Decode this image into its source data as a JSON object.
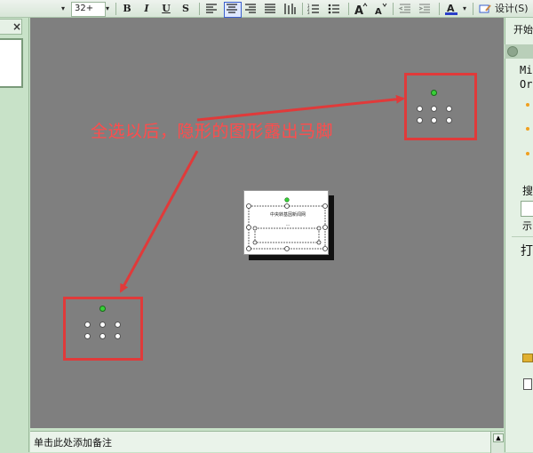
{
  "toolbar": {
    "font_size": "32+",
    "bold": "B",
    "italic": "I",
    "underline": "U",
    "shadow": "S",
    "design_label": "设计(S)"
  },
  "slide": {
    "annotation": "全选以后，隐形的图形露出马脚",
    "mini_title": "中央转基因新闻网",
    "mini_sub": "---"
  },
  "notes": {
    "placeholder": "单击此处添加备注"
  },
  "task_pane": {
    "title": "开始",
    "line1": "Mi",
    "line2": "Or",
    "search_label": "搜",
    "show_label": "示",
    "open_label": "打"
  },
  "colors": {
    "annotation_red": "#e03a3a",
    "slide_bg": "#7f7f7f",
    "pane_green": "#c8e2c8"
  }
}
